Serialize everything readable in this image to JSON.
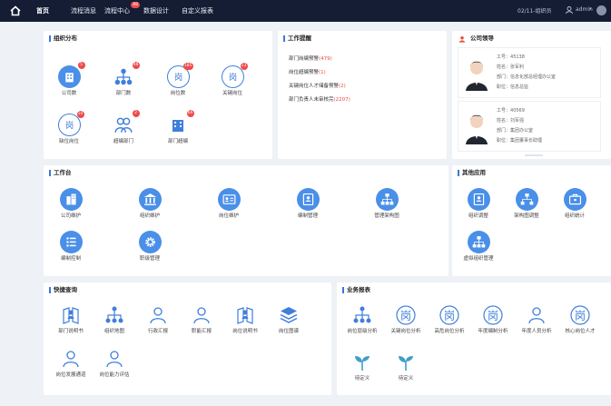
{
  "topbar": {
    "nav": [
      {
        "label": "首页"
      },
      {
        "label": "流程消息"
      },
      {
        "label": "流程中心",
        "badge": "88"
      },
      {
        "label": "数据设计"
      },
      {
        "label": "自定义报表"
      }
    ],
    "right_text": "02/11-组织员",
    "user_name": "admin",
    "colors": {
      "background": "#141d33",
      "badge": "#ef4b4b"
    }
  },
  "org": {
    "title": "组织分布",
    "items": [
      {
        "label": "公司数",
        "badge": "5",
        "icon": "building-icon"
      },
      {
        "label": "部门数",
        "badge": "48",
        "icon": "org-tree-icon"
      },
      {
        "label": "岗位数",
        "badge": "185",
        "icon": "post-icon"
      },
      {
        "label": "关键岗位",
        "badge": "13",
        "icon": "post-icon"
      },
      {
        "label": "缺位岗位",
        "badge": "10",
        "icon": "post-icon"
      },
      {
        "label": "超编部门",
        "badge": "2",
        "icon": "people-icon"
      },
      {
        "label": "部门超编",
        "badge": "66",
        "icon": "building-icon"
      }
    ]
  },
  "issues": {
    "title": "工作提醒",
    "items": [
      {
        "text": "部门岗编预警",
        "count": "(479)"
      },
      {
        "text": "岗位超编预警",
        "count": "(1)"
      },
      {
        "text": "关键岗位人才储备预警",
        "count": "(2)"
      },
      {
        "text": "部门负责人未审核完",
        "count": "(2207)"
      }
    ]
  },
  "leaders": {
    "title": "公司领导",
    "people": [
      {
        "id_label": "工号：",
        "id": "45138",
        "name_label": "姓名：",
        "name": "张军利",
        "dept_label": "部门：",
        "dept": "信息化部总经理办公室",
        "post_label": "职位：",
        "post": "信息总监"
      },
      {
        "id_label": "工号：",
        "id": "40569",
        "name_label": "姓名：",
        "name": "刘军强",
        "dept_label": "部门：",
        "dept": "集团办公室",
        "post_label": "职位：",
        "post": "集团董事长助理"
      }
    ]
  },
  "workbench": {
    "title": "工作台",
    "items": [
      {
        "label": "公司维护",
        "icon": "building-icon"
      },
      {
        "label": "组织维护",
        "icon": "bank-icon"
      },
      {
        "label": "岗位维护",
        "icon": "id-card-icon"
      },
      {
        "label": "编制管理",
        "icon": "profile-card-icon"
      },
      {
        "label": "管理架构图",
        "icon": "org-chart-icon"
      },
      {
        "label": "编制控制",
        "icon": "list-icon"
      },
      {
        "label": "职级管理",
        "icon": "gear-icon"
      }
    ]
  },
  "other_apps": {
    "title": "其他应用",
    "items": [
      {
        "label": "组织调整",
        "icon": "profile-card-icon"
      },
      {
        "label": "架构图调整",
        "icon": "org-chart-icon"
      },
      {
        "label": "组织统计",
        "icon": "briefcase-icon"
      },
      {
        "label": "虚拟组织管理",
        "icon": "org-chart-icon"
      }
    ]
  },
  "quick": {
    "title": "快捷查询",
    "items": [
      {
        "label": "部门说明书",
        "icon": "doc-person-icon"
      },
      {
        "label": "组织地图",
        "icon": "org-tree-icon"
      },
      {
        "label": "行政汇报",
        "icon": "person-icon"
      },
      {
        "label": "职能汇报",
        "icon": "person-icon"
      },
      {
        "label": "岗位说明书",
        "icon": "doc-person-icon"
      },
      {
        "label": "岗位图谱",
        "icon": "layers-icon"
      },
      {
        "label": "岗位发展通道",
        "icon": "person-icon"
      },
      {
        "label": "岗位能力评估",
        "icon": "person-icon"
      }
    ]
  },
  "reports": {
    "title": "业务报表",
    "items": [
      {
        "label": "岗位层级分析",
        "icon": "org-tree-icon"
      },
      {
        "label": "关键岗位分析",
        "icon": "post-icon"
      },
      {
        "label": "高危岗位分析",
        "icon": "post-icon"
      },
      {
        "label": "年度编制分析",
        "icon": "post-icon"
      },
      {
        "label": "年度人员分析",
        "icon": "person-icon"
      },
      {
        "label": "核心岗位人才",
        "icon": "post-icon"
      },
      {
        "label": "待定义",
        "icon": "sprout-icon"
      },
      {
        "label": "待定义",
        "icon": "sprout-icon"
      }
    ]
  }
}
